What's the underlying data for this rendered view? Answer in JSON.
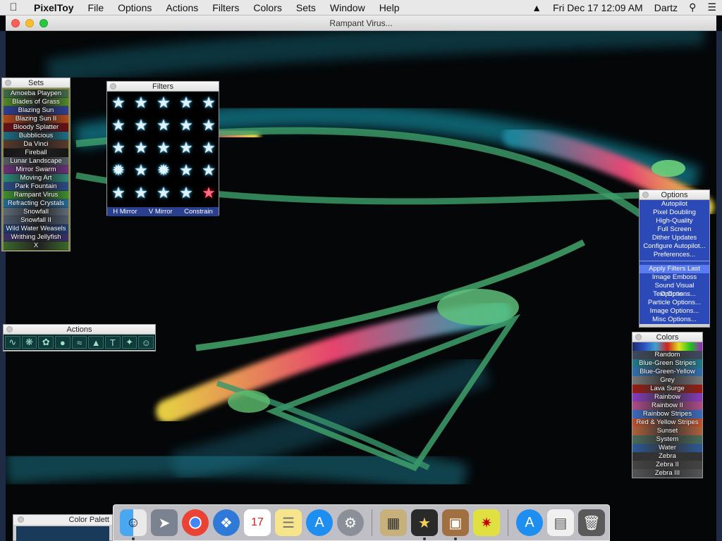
{
  "menubar": {
    "app": "PixelToy",
    "items": [
      "File",
      "Options",
      "Actions",
      "Filters",
      "Colors",
      "Sets",
      "Window",
      "Help"
    ],
    "datetime": "Fri Dec 17  12:09 AM",
    "user": "Dartz"
  },
  "window": {
    "title": "Rampant Virus..."
  },
  "sets": {
    "title": "Sets",
    "items": [
      {
        "label": "Amoeba Playpen",
        "color": "#3e6b4a"
      },
      {
        "label": "Blades of Grass",
        "color": "#4f8a2a"
      },
      {
        "label": "Blazing Sun",
        "color": "#2c3e9a"
      },
      {
        "label": "Blazing Sun II",
        "color": "#b54a1a"
      },
      {
        "label": "Bloody Splatter",
        "color": "#6a0f18"
      },
      {
        "label": "Bubblicious",
        "color": "#1b6f88"
      },
      {
        "label": "Da Vinci",
        "color": "#5a3a2a"
      },
      {
        "label": "Fireball",
        "color": "#151515"
      },
      {
        "label": "Lunar Landscape",
        "color": "#555c66"
      },
      {
        "label": "Mirror Swarm",
        "color": "#6b2f7a"
      },
      {
        "label": "Moving Art",
        "color": "#2a8a7a"
      },
      {
        "label": "Park Fountain",
        "color": "#2a4a8a"
      },
      {
        "label": "Rampant Virus",
        "color": "#3c8f2e"
      },
      {
        "label": "Refracting Crystals",
        "color": "#1e6aa0"
      },
      {
        "label": "Snowfall",
        "color": "#5f6b78"
      },
      {
        "label": "Snowfall II",
        "color": "#4e5a6e"
      },
      {
        "label": "Wild Water Weasels",
        "color": "#1a3d7a"
      },
      {
        "label": "Writhing Jellyfish",
        "color": "#3a2f6a"
      },
      {
        "label": "X",
        "color": "#3a6a2a"
      }
    ]
  },
  "filters": {
    "title": "Filters",
    "bottom": [
      "H Mirror",
      "V Mirror",
      "Constrain"
    ]
  },
  "options": {
    "title": "Options",
    "items": [
      "Autopilot",
      "Pixel Doubling",
      "High-Quality",
      "Full Screen",
      "Dither Updates",
      "Configure Autopilot...",
      "Preferences..."
    ],
    "items2": [
      "Apply Filters Last",
      "Image Emboss",
      "Sound Visual Options...",
      "Text Options...",
      "Particle Options...",
      "Image Options...",
      "Misc Options..."
    ]
  },
  "colors": {
    "title": "Colors",
    "items": [
      {
        "label": "Random",
        "color": "#3f4a60"
      },
      {
        "label": "Blue-Green Stripes",
        "color": "#1e7a8a"
      },
      {
        "label": "Blue-Green-Yellow",
        "color": "#2f6fb0"
      },
      {
        "label": "Grey",
        "color": "#777777"
      },
      {
        "label": "Lava Surge",
        "color": "#9a1a12"
      },
      {
        "label": "Rainbow",
        "color": "#8a3ac0"
      },
      {
        "label": "Rainbow II",
        "color": "#b04a8a"
      },
      {
        "label": "Rainbow Stripes",
        "color": "#3a6ac0"
      },
      {
        "label": "Red & Yellow Stripes",
        "color": "#c0502a"
      },
      {
        "label": "Sunset",
        "color": "#b0603a"
      },
      {
        "label": "System",
        "color": "#4a6a5a"
      },
      {
        "label": "Water",
        "color": "#2a5a9a"
      },
      {
        "label": "Zebra",
        "color": "#333333"
      },
      {
        "label": "Zebra II",
        "color": "#444444"
      },
      {
        "label": "Zebra III",
        "color": "#555555"
      }
    ]
  },
  "actions": {
    "title": "Actions"
  },
  "colorpalette": {
    "title": "Color Palett"
  }
}
